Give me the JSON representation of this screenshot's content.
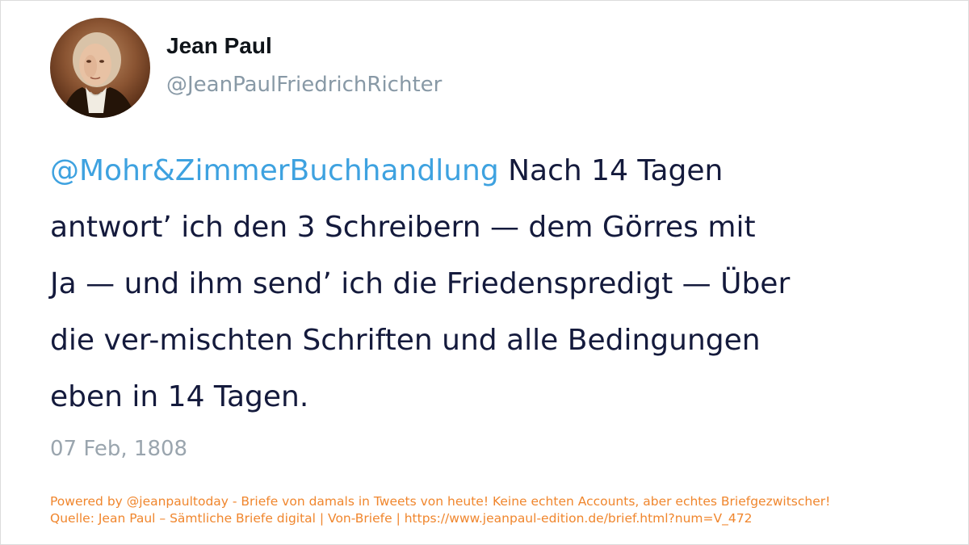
{
  "author": {
    "name": "Jean Paul",
    "handle": "@JeanPaulFriedrichRichter",
    "avatar_icon": "portrait-avatar-icon"
  },
  "tweet": {
    "mention": "@Mohr&ZimmerBuchhandlung",
    "lines": [
      " Nach 14 Tagen",
      "antwort’ ich den 3 Schreibern — dem Görres mit",
      "Ja — und ihm send’ ich die Friedenspredigt — Über",
      "die ver-mischten Schriften und alle Bedingungen",
      "eben in 14 Tagen."
    ],
    "date": "07 Feb, 1808"
  },
  "footer": {
    "powered_by": "Powered by @jeanpaultoday - Briefe von damals in Tweets von heute! Keine echten Accounts, aber echtes Briefgezwitscher!",
    "source": "Quelle: Jean Paul – Sämtliche Briefe digital | Von-Briefe | https://www.jeanpaul-edition.de/brief.html?num=V_472"
  },
  "colors": {
    "mention": "#3ea2e0",
    "text": "#141a3c",
    "secondary": "#8899a6",
    "footer": "#f0862d"
  }
}
